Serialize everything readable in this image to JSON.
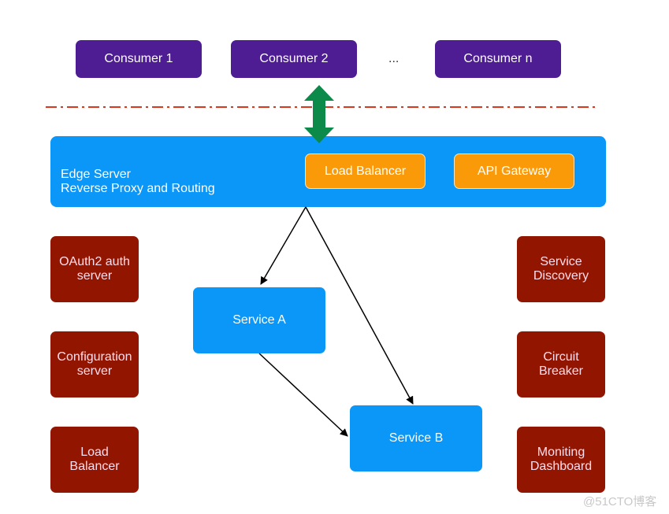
{
  "consumers": [
    "Consumer 1",
    "Consumer 2",
    "Consumer n"
  ],
  "ellipsis": "...",
  "edge_server": {
    "line1": "Edge Server",
    "line2": "Reverse Proxy and Routing",
    "load_balancer": "Load Balancer",
    "api_gateway": "API Gateway"
  },
  "left_boxes": [
    "OAuth2 auth\nserver",
    "Configuration\nserver",
    "Load\nBalancer"
  ],
  "right_boxes": [
    "Service\nDiscovery",
    "Circuit\nBreaker",
    "Moniting\nDashboard"
  ],
  "services": {
    "a": "Service A",
    "b": "Service B"
  },
  "watermark": "@51CTO博客",
  "colors": {
    "consumer": "#4e1c93",
    "edge": "#0a97f7",
    "orange": "#fb9a08",
    "infra": "#921500",
    "arrow": "#0b8a4a",
    "boundary": "#d9381e"
  }
}
